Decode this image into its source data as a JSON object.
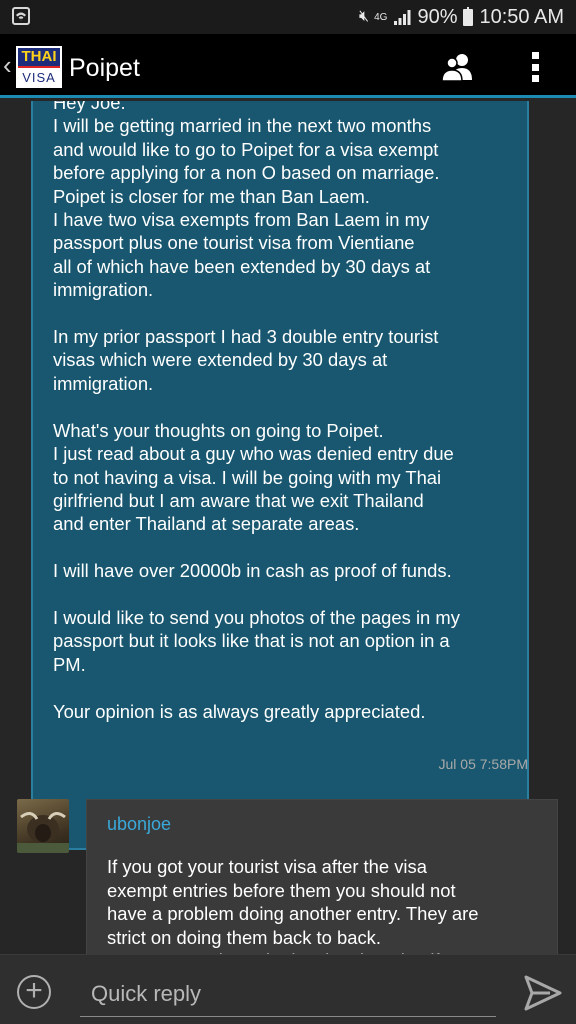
{
  "status_bar": {
    "network": "4G",
    "battery": "90%",
    "time": "10:50 AM"
  },
  "app_bar": {
    "logo_top": "THAI",
    "logo_bottom": "VISA",
    "title": "Poipet"
  },
  "messages": [
    {
      "author": "",
      "text": "Hey Joe.\nI will be getting married in the next two months\nand would like to go to Poipet for a visa exempt\nbefore applying for a non O based on marriage.\nPoipet is closer for me than Ban Laem.\nI have two visa exempts from Ban Laem in my\npassport plus one tourist visa from Vientiane\nall of which have been extended by 30 days at\nimmigration.\n\nIn my prior passport I had 3 double entry tourist\nvisas which were extended by 30 days at\nimmigration.\n\nWhat's your thoughts on going to Poipet.\nI just read about a guy who was denied entry due\nto not having a visa. I will be going with my Thai\ngirlfriend but I am aware that we exit Thailand\nand enter Thailand at separate areas.\n\nI will have over 20000b in cash as proof of funds.\n\nI would like to send you photos of the pages in my\npassport but it looks like that is not an option in a\nPM.\n\nYour opinion is as always greatly appreciated.",
      "time": "Jul 05 7:58PM"
    },
    {
      "author": "ubonjoe",
      "text": "If you got your tourist visa after the visa\nexempt entries before them you should not\nhave a problem doing another entry. They are\nstrict on doing them back to back.\nYou may get through ok using the mine if"
    }
  ],
  "reply": {
    "placeholder": "Quick reply"
  }
}
